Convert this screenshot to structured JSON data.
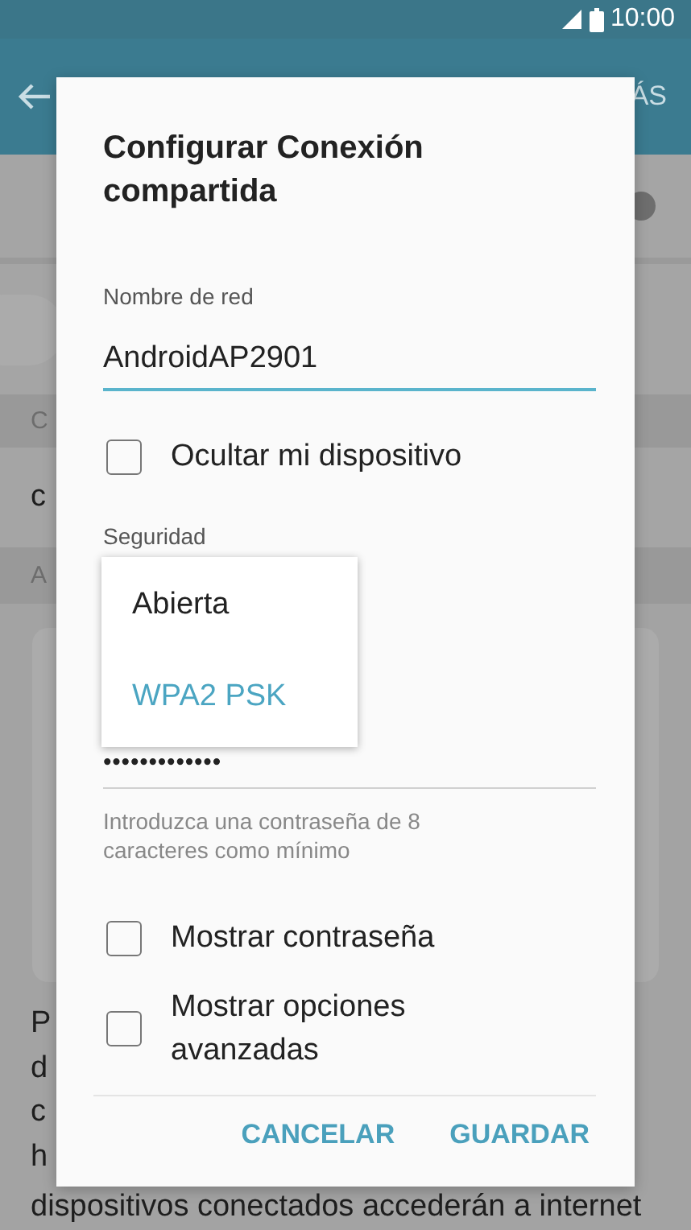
{
  "status_bar": {
    "time": "10:00"
  },
  "app_bar": {
    "action_fragment": "ÁS"
  },
  "background": {
    "toggle": {
      "on": false
    },
    "rows": [
      {
        "kind": "header",
        "text": "C"
      },
      {
        "kind": "item",
        "text": "c"
      },
      {
        "kind": "header",
        "text": "A"
      }
    ],
    "paragraph_lines": [
      "P",
      "d",
      "c",
      "h",
      "dispositivos conectados accederán a internet"
    ]
  },
  "dialog": {
    "title": "Configurar Conexión compartida",
    "network_name": {
      "label": "Nombre de red",
      "value": "AndroidAP2901"
    },
    "hide_device": {
      "label": "Ocultar mi dispositivo",
      "checked": false
    },
    "security": {
      "label": "Seguridad",
      "menu": [
        {
          "label": "Abierta",
          "selected": false
        },
        {
          "label": "WPA2 PSK",
          "selected": true
        }
      ]
    },
    "password": {
      "value": "•••••••••••••",
      "hint": "Introduzca una contraseña de 8 caracteres como mínimo"
    },
    "options": [
      {
        "label": "Mostrar contraseña",
        "checked": false
      },
      {
        "label": "Mostrar opciones avanzadas",
        "checked": false
      }
    ],
    "buttons": [
      {
        "label": "CANCELAR"
      },
      {
        "label": "GUARDAR"
      }
    ]
  }
}
